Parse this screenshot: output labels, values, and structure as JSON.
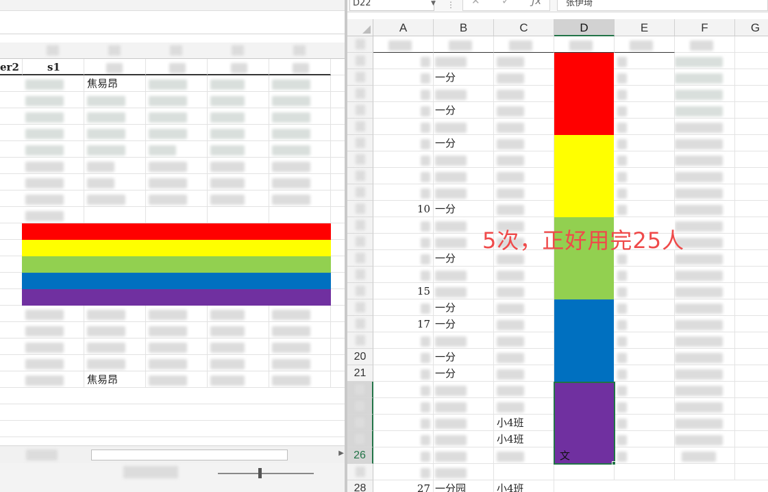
{
  "left": {
    "header_cells": [
      "er2",
      "s1",
      "",
      "",
      "",
      ""
    ],
    "names": {
      "r1_b": "焦易昂",
      "r18_b": "焦易昂"
    },
    "band_colors": [
      "#ff0000",
      "#ffff00",
      "#92d050",
      "#0070c0",
      "#7030a0"
    ]
  },
  "right": {
    "namebox": "D22",
    "formula_value": "张伊琦",
    "columns": [
      "A",
      "B",
      "C",
      "D",
      "E",
      "F",
      "G"
    ],
    "rows": {
      "r20": "20",
      "r21": "21",
      "r26": "26",
      "r28": "28"
    },
    "cells": {
      "a10": "10",
      "a15": "15",
      "a17": "17",
      "a27": "27",
      "b_branch": "一分",
      "b28": "一分园",
      "c24": "小4班",
      "c25": "小4班",
      "c28": "小4班",
      "d26": "文"
    },
    "d_color_groups": [
      {
        "color": "#ff0000",
        "rows": 5
      },
      {
        "color": "#ffff00",
        "rows": 5
      },
      {
        "color": "#92d050",
        "rows": 5
      },
      {
        "color": "#0070c0",
        "rows": 5
      },
      {
        "color": "#7030a0",
        "rows": 5
      }
    ],
    "annotation": "5次，正好用完25人"
  }
}
